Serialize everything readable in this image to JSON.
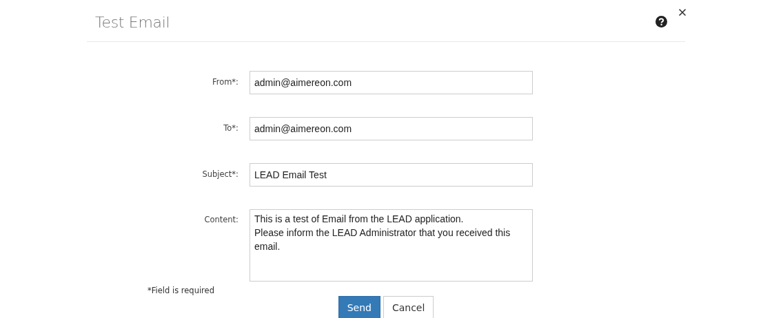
{
  "dialog": {
    "title": "Test Email",
    "fields": [
      {
        "label": "From*:",
        "kind": "input",
        "value": "admin@aimereon.com"
      },
      {
        "label": "To*:",
        "kind": "input",
        "value": "admin@aimereon.com"
      },
      {
        "label": "Subject*:",
        "kind": "input",
        "value": "LEAD Email Test"
      },
      {
        "label": "Content:",
        "kind": "textarea",
        "value": "This is a test of Email from the LEAD application.\nPlease inform the LEAD Administrator that you received this email."
      }
    ],
    "required_note": "*Field is required",
    "buttons": [
      {
        "label": "Send",
        "kind": "primary"
      },
      {
        "label": "Cancel",
        "kind": "default"
      }
    ]
  }
}
